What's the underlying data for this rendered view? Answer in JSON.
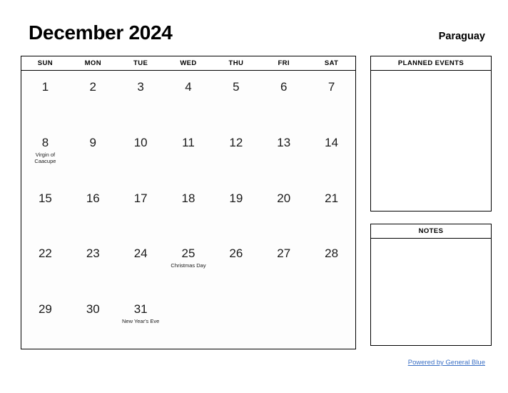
{
  "header": {
    "month_title": "December 2024",
    "country": "Paraguay"
  },
  "calendar": {
    "weekdays": [
      "SUN",
      "MON",
      "TUE",
      "WED",
      "THU",
      "FRI",
      "SAT"
    ],
    "weeks": [
      [
        {
          "day": "1",
          "event": ""
        },
        {
          "day": "2",
          "event": ""
        },
        {
          "day": "3",
          "event": ""
        },
        {
          "day": "4",
          "event": ""
        },
        {
          "day": "5",
          "event": ""
        },
        {
          "day": "6",
          "event": ""
        },
        {
          "day": "7",
          "event": ""
        }
      ],
      [
        {
          "day": "8",
          "event": "Virgin of Caacupe"
        },
        {
          "day": "9",
          "event": ""
        },
        {
          "day": "10",
          "event": ""
        },
        {
          "day": "11",
          "event": ""
        },
        {
          "day": "12",
          "event": ""
        },
        {
          "day": "13",
          "event": ""
        },
        {
          "day": "14",
          "event": ""
        }
      ],
      [
        {
          "day": "15",
          "event": ""
        },
        {
          "day": "16",
          "event": ""
        },
        {
          "day": "17",
          "event": ""
        },
        {
          "day": "18",
          "event": ""
        },
        {
          "day": "19",
          "event": ""
        },
        {
          "day": "20",
          "event": ""
        },
        {
          "day": "21",
          "event": ""
        }
      ],
      [
        {
          "day": "22",
          "event": ""
        },
        {
          "day": "23",
          "event": ""
        },
        {
          "day": "24",
          "event": ""
        },
        {
          "day": "25",
          "event": "Christmas Day"
        },
        {
          "day": "26",
          "event": ""
        },
        {
          "day": "27",
          "event": ""
        },
        {
          "day": "28",
          "event": ""
        }
      ],
      [
        {
          "day": "29",
          "event": ""
        },
        {
          "day": "30",
          "event": ""
        },
        {
          "day": "31",
          "event": "New Year's Eve"
        },
        {
          "day": "",
          "event": ""
        },
        {
          "day": "",
          "event": ""
        },
        {
          "day": "",
          "event": ""
        },
        {
          "day": "",
          "event": ""
        }
      ]
    ]
  },
  "panels": [
    {
      "title": "PLANNED EVENTS",
      "body": ""
    },
    {
      "title": "NOTES",
      "body": ""
    }
  ],
  "footer": {
    "link_text": "Powered by General Blue",
    "link_color": "#3a6fc4"
  }
}
